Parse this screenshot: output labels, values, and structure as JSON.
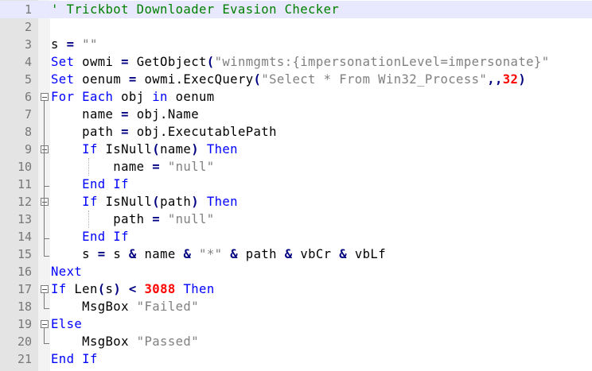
{
  "editor": {
    "language": "VBScript",
    "colors": {
      "comment": "#008000",
      "keyword": "#0000ff",
      "string": "#808080",
      "number": "#ff0000",
      "operator": "#000080",
      "current_line": "#e8e8ff",
      "gutter": "#e4e4e4"
    },
    "lines": [
      {
        "n": "1",
        "current": true,
        "tokens": [
          {
            "t": "cm",
            "v": "' Trickbot Downloader Evasion Checker"
          }
        ]
      },
      {
        "n": "2",
        "tokens": []
      },
      {
        "n": "3",
        "tokens": [
          {
            "t": "id",
            "v": "s "
          },
          {
            "t": "op",
            "v": "="
          },
          {
            "t": "id",
            "v": " "
          },
          {
            "t": "st",
            "v": "\"\""
          }
        ]
      },
      {
        "n": "4",
        "tokens": [
          {
            "t": "kw",
            "v": "Set"
          },
          {
            "t": "id",
            "v": " owmi "
          },
          {
            "t": "op",
            "v": "="
          },
          {
            "t": "id",
            "v": " GetObject"
          },
          {
            "t": "op",
            "v": "("
          },
          {
            "t": "st",
            "v": "\"winmgmts:{impersonationLevel=impersonate}\""
          }
        ]
      },
      {
        "n": "5",
        "tokens": [
          {
            "t": "kw",
            "v": "Set"
          },
          {
            "t": "id",
            "v": " oenum "
          },
          {
            "t": "op",
            "v": "="
          },
          {
            "t": "id",
            "v": " owmi.ExecQuery"
          },
          {
            "t": "op",
            "v": "("
          },
          {
            "t": "st",
            "v": "\"Select * From Win32_Process\""
          },
          {
            "t": "op",
            "v": ",,"
          },
          {
            "t": "nm",
            "v": "32"
          },
          {
            "t": "op",
            "v": ")"
          }
        ]
      },
      {
        "n": "6",
        "fold": "start",
        "tokens": [
          {
            "t": "kw",
            "v": "For Each"
          },
          {
            "t": "id",
            "v": " obj "
          },
          {
            "t": "kw",
            "v": "in"
          },
          {
            "t": "id",
            "v": " oenum"
          }
        ]
      },
      {
        "n": "7",
        "tokens": [
          {
            "t": "id",
            "v": "    name "
          },
          {
            "t": "op",
            "v": "="
          },
          {
            "t": "id",
            "v": " obj.Name"
          }
        ]
      },
      {
        "n": "8",
        "tokens": [
          {
            "t": "id",
            "v": "    path "
          },
          {
            "t": "op",
            "v": "="
          },
          {
            "t": "id",
            "v": " obj.ExecutablePath"
          }
        ]
      },
      {
        "n": "9",
        "fold": "start",
        "tokens": [
          {
            "t": "id",
            "v": "    "
          },
          {
            "t": "kw",
            "v": "If"
          },
          {
            "t": "id",
            "v": " IsNull"
          },
          {
            "t": "op",
            "v": "("
          },
          {
            "t": "id",
            "v": "name"
          },
          {
            "t": "op",
            "v": ")"
          },
          {
            "t": "id",
            "v": " "
          },
          {
            "t": "kw",
            "v": "Then"
          }
        ]
      },
      {
        "n": "10",
        "tokens": [
          {
            "t": "id",
            "v": "        name "
          },
          {
            "t": "op",
            "v": "="
          },
          {
            "t": "id",
            "v": " "
          },
          {
            "t": "st",
            "v": "\"null\""
          }
        ]
      },
      {
        "n": "11",
        "fold": "end",
        "tokens": [
          {
            "t": "id",
            "v": "    "
          },
          {
            "t": "kw",
            "v": "End If"
          }
        ]
      },
      {
        "n": "12",
        "fold": "start",
        "tokens": [
          {
            "t": "id",
            "v": "    "
          },
          {
            "t": "kw",
            "v": "If"
          },
          {
            "t": "id",
            "v": " IsNull"
          },
          {
            "t": "op",
            "v": "("
          },
          {
            "t": "id",
            "v": "path"
          },
          {
            "t": "op",
            "v": ")"
          },
          {
            "t": "id",
            "v": " "
          },
          {
            "t": "kw",
            "v": "Then"
          }
        ]
      },
      {
        "n": "13",
        "tokens": [
          {
            "t": "id",
            "v": "        path "
          },
          {
            "t": "op",
            "v": "="
          },
          {
            "t": "id",
            "v": " "
          },
          {
            "t": "st",
            "v": "\"null\""
          }
        ]
      },
      {
        "n": "14",
        "fold": "end",
        "tokens": [
          {
            "t": "id",
            "v": "    "
          },
          {
            "t": "kw",
            "v": "End If"
          }
        ]
      },
      {
        "n": "15",
        "fold": "end",
        "tokens": [
          {
            "t": "id",
            "v": "    s "
          },
          {
            "t": "op",
            "v": "="
          },
          {
            "t": "id",
            "v": " s "
          },
          {
            "t": "op",
            "v": "&"
          },
          {
            "t": "id",
            "v": " name "
          },
          {
            "t": "op",
            "v": "&"
          },
          {
            "t": "id",
            "v": " "
          },
          {
            "t": "st",
            "v": "\"*\""
          },
          {
            "t": "id",
            "v": " "
          },
          {
            "t": "op",
            "v": "&"
          },
          {
            "t": "id",
            "v": " path "
          },
          {
            "t": "op",
            "v": "&"
          },
          {
            "t": "id",
            "v": " vbCr "
          },
          {
            "t": "op",
            "v": "&"
          },
          {
            "t": "id",
            "v": " vbLf"
          }
        ]
      },
      {
        "n": "16",
        "tokens": [
          {
            "t": "kw",
            "v": "Next"
          }
        ]
      },
      {
        "n": "17",
        "fold": "start",
        "tokens": [
          {
            "t": "kw",
            "v": "If"
          },
          {
            "t": "id",
            "v": " Len"
          },
          {
            "t": "op",
            "v": "("
          },
          {
            "t": "id",
            "v": "s"
          },
          {
            "t": "op",
            "v": ")"
          },
          {
            "t": "id",
            "v": " "
          },
          {
            "t": "op",
            "v": "<"
          },
          {
            "t": "id",
            "v": " "
          },
          {
            "t": "nm",
            "v": "3088"
          },
          {
            "t": "id",
            "v": " "
          },
          {
            "t": "kw",
            "v": "Then"
          }
        ]
      },
      {
        "n": "18",
        "fold": "end",
        "tokens": [
          {
            "t": "id",
            "v": "    MsgBox "
          },
          {
            "t": "st",
            "v": "\"Failed\""
          }
        ]
      },
      {
        "n": "19",
        "fold": "start",
        "tokens": [
          {
            "t": "kw",
            "v": "Else"
          }
        ]
      },
      {
        "n": "20",
        "fold": "end",
        "tokens": [
          {
            "t": "id",
            "v": "    MsgBox "
          },
          {
            "t": "st",
            "v": "\"Passed\""
          }
        ]
      },
      {
        "n": "21",
        "tokens": [
          {
            "t": "kw",
            "v": "End If"
          }
        ]
      }
    ]
  }
}
